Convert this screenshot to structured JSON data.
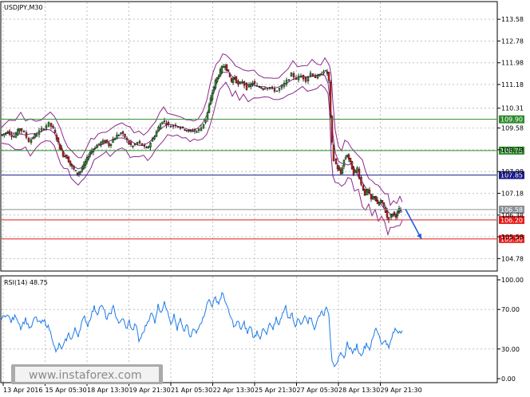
{
  "chart_data": {
    "type": "line",
    "symbol_label": "USDJPY,M30",
    "price_panel": {
      "y_ticks": [
        "113.58",
        "112.78",
        "111.98",
        "111.18",
        "110.31",
        "109.58",
        "108.78",
        "107.98",
        "107.18",
        "106.38",
        "105.58",
        "104.78"
      ],
      "y_tick_values": [
        113.58,
        112.78,
        111.98,
        111.18,
        110.31,
        109.58,
        108.78,
        107.98,
        107.18,
        106.38,
        105.58,
        104.78
      ],
      "ylim": [
        104.35,
        114.2
      ],
      "levels": [
        {
          "label": "109.90",
          "value": 109.9,
          "color": "#2e8b2e"
        },
        {
          "label": "108.75",
          "value": 108.75,
          "color": "#2e8b2e"
        },
        {
          "label": "107.85",
          "value": 107.85,
          "color": "#1c1c8c"
        },
        {
          "label": "106.58",
          "value": 106.58,
          "color": "#8c9196"
        },
        {
          "label": "106.20",
          "value": 106.2,
          "color": "#e51b1b"
        },
        {
          "label": "105.50",
          "value": 105.5,
          "color": "#e51b1b"
        }
      ],
      "price_path": [
        [
          0,
          109.3
        ],
        [
          9,
          109.45
        ],
        [
          17,
          109.25
        ],
        [
          24,
          109.58
        ],
        [
          30,
          109.4
        ],
        [
          36,
          109.1
        ],
        [
          43,
          109.3
        ],
        [
          49,
          109.45
        ],
        [
          55,
          109.6
        ],
        [
          61,
          109.75
        ],
        [
          66,
          109.55
        ],
        [
          70,
          109.2
        ],
        [
          74,
          108.85
        ],
        [
          78,
          108.6
        ],
        [
          83,
          108.5
        ],
        [
          87,
          108.25
        ],
        [
          92,
          108.05
        ],
        [
          96,
          107.9
        ],
        [
          100,
          108.0
        ],
        [
          104,
          108.2
        ],
        [
          108,
          108.45
        ],
        [
          112,
          108.7
        ],
        [
          116,
          108.8
        ],
        [
          121,
          108.95
        ],
        [
          126,
          109.05
        ],
        [
          131,
          109.1
        ],
        [
          136,
          108.95
        ],
        [
          141,
          109.15
        ],
        [
          146,
          109.3
        ],
        [
          151,
          109.4
        ],
        [
          156,
          109.25
        ],
        [
          161,
          109.0
        ],
        [
          166,
          108.9
        ],
        [
          172,
          109.05
        ],
        [
          178,
          108.95
        ],
        [
          183,
          108.8
        ],
        [
          188,
          109.05
        ],
        [
          193,
          109.3
        ],
        [
          198,
          109.6
        ],
        [
          203,
          109.85
        ],
        [
          208,
          109.75
        ],
        [
          214,
          109.65
        ],
        [
          220,
          109.7
        ],
        [
          226,
          109.6
        ],
        [
          231,
          109.55
        ],
        [
          236,
          109.45
        ],
        [
          241,
          109.5
        ],
        [
          246,
          109.45
        ],
        [
          252,
          109.6
        ],
        [
          257,
          109.9
        ],
        [
          261,
          110.4
        ],
        [
          265,
          110.9
        ],
        [
          269,
          111.3
        ],
        [
          273,
          111.55
        ],
        [
          277,
          111.8
        ],
        [
          281,
          111.9
        ],
        [
          285,
          111.6
        ],
        [
          289,
          111.3
        ],
        [
          293,
          111.45
        ],
        [
          298,
          111.15
        ],
        [
          303,
          111.3
        ],
        [
          309,
          111.05
        ],
        [
          316,
          111.25
        ],
        [
          322,
          111.1
        ],
        [
          329,
          111.05
        ],
        [
          335,
          111.1
        ],
        [
          341,
          111.0
        ],
        [
          347,
          110.95
        ],
        [
          353,
          111.1
        ],
        [
          359,
          111.3
        ],
        [
          365,
          111.55
        ],
        [
          371,
          111.4
        ],
        [
          377,
          111.5
        ],
        [
          383,
          111.35
        ],
        [
          389,
          111.6
        ],
        [
          395,
          111.45
        ],
        [
          400,
          111.5
        ],
        [
          405,
          111.7
        ],
        [
          409,
          111.6
        ],
        [
          411,
          111.3
        ],
        [
          413,
          110.0
        ],
        [
          415,
          109.0
        ],
        [
          418,
          108.4
        ],
        [
          422,
          108.1
        ],
        [
          426,
          107.9
        ],
        [
          430,
          108.4
        ],
        [
          434,
          108.6
        ],
        [
          438,
          108.3
        ],
        [
          442,
          107.9
        ],
        [
          447,
          108.1
        ],
        [
          452,
          107.5
        ],
        [
          456,
          107.15
        ],
        [
          460,
          107.3
        ],
        [
          464,
          106.95
        ],
        [
          468,
          107.1
        ],
        [
          472,
          106.75
        ],
        [
          476,
          106.9
        ],
        [
          480,
          106.7
        ],
        [
          484,
          106.3
        ],
        [
          487,
          106.25
        ],
        [
          491,
          106.45
        ],
        [
          495,
          106.35
        ],
        [
          499,
          106.58
        ],
        [
          502,
          106.55
        ]
      ],
      "forecast_arrow": {
        "from": [
          506,
          106.6
        ],
        "to": [
          526,
          105.5
        ],
        "color": "#1f5fe0"
      }
    },
    "rsi_panel": {
      "label": "RSI(14) 48.75",
      "y_ticks": [
        "100.00",
        "70.00",
        "30.00",
        "0.00"
      ],
      "y_tick_values": [
        100,
        70,
        30,
        0
      ],
      "ylim": [
        0,
        100
      ],
      "reference_levels": [
        70,
        30
      ],
      "rsi_path": [
        [
          0,
          60
        ],
        [
          6,
          66
        ],
        [
          12,
          58
        ],
        [
          18,
          64
        ],
        [
          24,
          52
        ],
        [
          30,
          60
        ],
        [
          36,
          50
        ],
        [
          42,
          62
        ],
        [
          48,
          56
        ],
        [
          54,
          58
        ],
        [
          60,
          50
        ],
        [
          64,
          40
        ],
        [
          68,
          26
        ],
        [
          72,
          34
        ],
        [
          76,
          30
        ],
        [
          80,
          38
        ],
        [
          84,
          45
        ],
        [
          88,
          40
        ],
        [
          92,
          50
        ],
        [
          96,
          44
        ],
        [
          100,
          56
        ],
        [
          104,
          62
        ],
        [
          108,
          54
        ],
        [
          112,
          64
        ],
        [
          116,
          72
        ],
        [
          120,
          66
        ],
        [
          124,
          74
        ],
        [
          128,
          70
        ],
        [
          132,
          60
        ],
        [
          136,
          66
        ],
        [
          140,
          72
        ],
        [
          144,
          62
        ],
        [
          148,
          55
        ],
        [
          152,
          62
        ],
        [
          156,
          50
        ],
        [
          160,
          58
        ],
        [
          164,
          48
        ],
        [
          168,
          56
        ],
        [
          172,
          38
        ],
        [
          176,
          44
        ],
        [
          180,
          52
        ],
        [
          184,
          60
        ],
        [
          188,
          66
        ],
        [
          192,
          58
        ],
        [
          196,
          74
        ],
        [
          200,
          68
        ],
        [
          204,
          76
        ],
        [
          208,
          70
        ],
        [
          212,
          56
        ],
        [
          216,
          64
        ],
        [
          220,
          50
        ],
        [
          224,
          60
        ],
        [
          228,
          46
        ],
        [
          232,
          56
        ],
        [
          236,
          40
        ],
        [
          240,
          50
        ],
        [
          244,
          46
        ],
        [
          248,
          56
        ],
        [
          252,
          60
        ],
        [
          256,
          72
        ],
        [
          260,
          80
        ],
        [
          264,
          74
        ],
        [
          268,
          82
        ],
        [
          272,
          76
        ],
        [
          276,
          86
        ],
        [
          280,
          80
        ],
        [
          284,
          68
        ],
        [
          288,
          60
        ],
        [
          292,
          52
        ],
        [
          296,
          58
        ],
        [
          300,
          50
        ],
        [
          304,
          56
        ],
        [
          308,
          46
        ],
        [
          312,
          54
        ],
        [
          316,
          40
        ],
        [
          320,
          48
        ],
        [
          324,
          42
        ],
        [
          328,
          50
        ],
        [
          332,
          44
        ],
        [
          336,
          56
        ],
        [
          340,
          48
        ],
        [
          344,
          62
        ],
        [
          348,
          54
        ],
        [
          352,
          68
        ],
        [
          356,
          72
        ],
        [
          360,
          60
        ],
        [
          364,
          66
        ],
        [
          368,
          52
        ],
        [
          372,
          62
        ],
        [
          376,
          54
        ],
        [
          380,
          66
        ],
        [
          384,
          58
        ],
        [
          388,
          62
        ],
        [
          392,
          50
        ],
        [
          396,
          60
        ],
        [
          400,
          68
        ],
        [
          404,
          66
        ],
        [
          408,
          72
        ],
        [
          410,
          64
        ],
        [
          412,
          40
        ],
        [
          414,
          20
        ],
        [
          417,
          14
        ],
        [
          421,
          18
        ],
        [
          425,
          24
        ],
        [
          429,
          20
        ],
        [
          433,
          36
        ],
        [
          437,
          30
        ],
        [
          441,
          26
        ],
        [
          445,
          34
        ],
        [
          449,
          24
        ],
        [
          453,
          28
        ],
        [
          457,
          36
        ],
        [
          461,
          30
        ],
        [
          465,
          40
        ],
        [
          469,
          52
        ],
        [
          473,
          44
        ],
        [
          477,
          34
        ],
        [
          481,
          40
        ],
        [
          485,
          30
        ],
        [
          489,
          42
        ],
        [
          493,
          50
        ],
        [
          497,
          48
        ],
        [
          502,
          48.75
        ]
      ]
    },
    "x_ticks": [
      "13 Apr 2016",
      "15 Apr 05:30",
      "18 Apr 13:30",
      "19 Apr 21:30",
      "21 Apr 05:30",
      "22 Apr 13:30",
      "25 Apr 21:30",
      "27 Apr 05:30",
      "28 Apr 13:30",
      "29 Apr 21:30"
    ],
    "grid": true,
    "watermark": "www.instaforex.com",
    "colors": {
      "price": "#000000",
      "bullish": "#2e9a2e",
      "bearish": "#d22222",
      "bands": "#8b2a8b",
      "rsi": "#1e7be6",
      "grid": "#c0c0c0"
    }
  }
}
